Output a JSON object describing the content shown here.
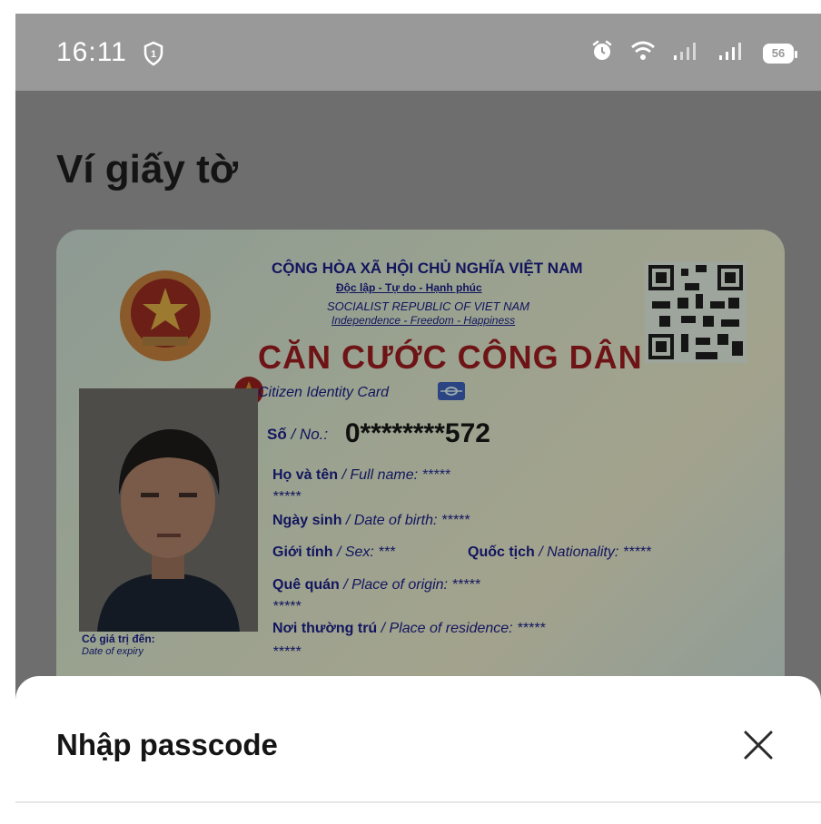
{
  "status_bar": {
    "time": "16:11",
    "battery": "56",
    "icons": [
      "shield-icon",
      "alarm-icon",
      "wifi-icon",
      "signal-icon",
      "signal-icon",
      "battery-icon"
    ]
  },
  "page": {
    "title": "Ví giấy tờ"
  },
  "card": {
    "header_line1": "CỘNG HÒA XÃ HỘI CHỦ NGHĨA VIỆT NAM",
    "header_line2": "Độc lập - Tự do - Hạnh phúc",
    "header_line3": "SOCIALIST REPUBLIC OF VIET NAM",
    "header_line4": "Independence - Freedom - Happiness",
    "card_title": "CĂN CƯỚC CÔNG DÂN",
    "card_subtitle": "Citizen Identity Card",
    "number_label": "Số",
    "number_label_en": "/ No.:",
    "number": "0********572",
    "fullname_label": "Họ và tên",
    "fullname_label_en": "/ Full name:",
    "fullname_value": "*****",
    "fullname_value_line2": "*****",
    "dob_label": "Ngày sinh",
    "dob_label_en": "/ Date of birth:",
    "dob_value": "*****",
    "sex_label": "Giới tính",
    "sex_label_en": "/ Sex:",
    "sex_value": "***",
    "nationality_label": "Quốc tịch",
    "nationality_label_en": "/ Nationality:",
    "nationality_value": "*****",
    "origin_label": "Quê quán",
    "origin_label_en": "/ Place of origin:",
    "origin_value": "*****",
    "origin_value_line2": "*****",
    "residence_label": "Nơi thường trú",
    "residence_label_en": "/ Place of residence:",
    "residence_value": "*****",
    "residence_value_line2": "*****",
    "expiry_label": "Có giá trị đến:",
    "expiry_label_en": "Date of expiry"
  },
  "sheet": {
    "title": "Nhập passcode",
    "close_icon": "close-icon"
  },
  "colors": {
    "status_bar": "#999999",
    "overlay": "#6e6e6e",
    "sheet_background": "#ffffff"
  }
}
